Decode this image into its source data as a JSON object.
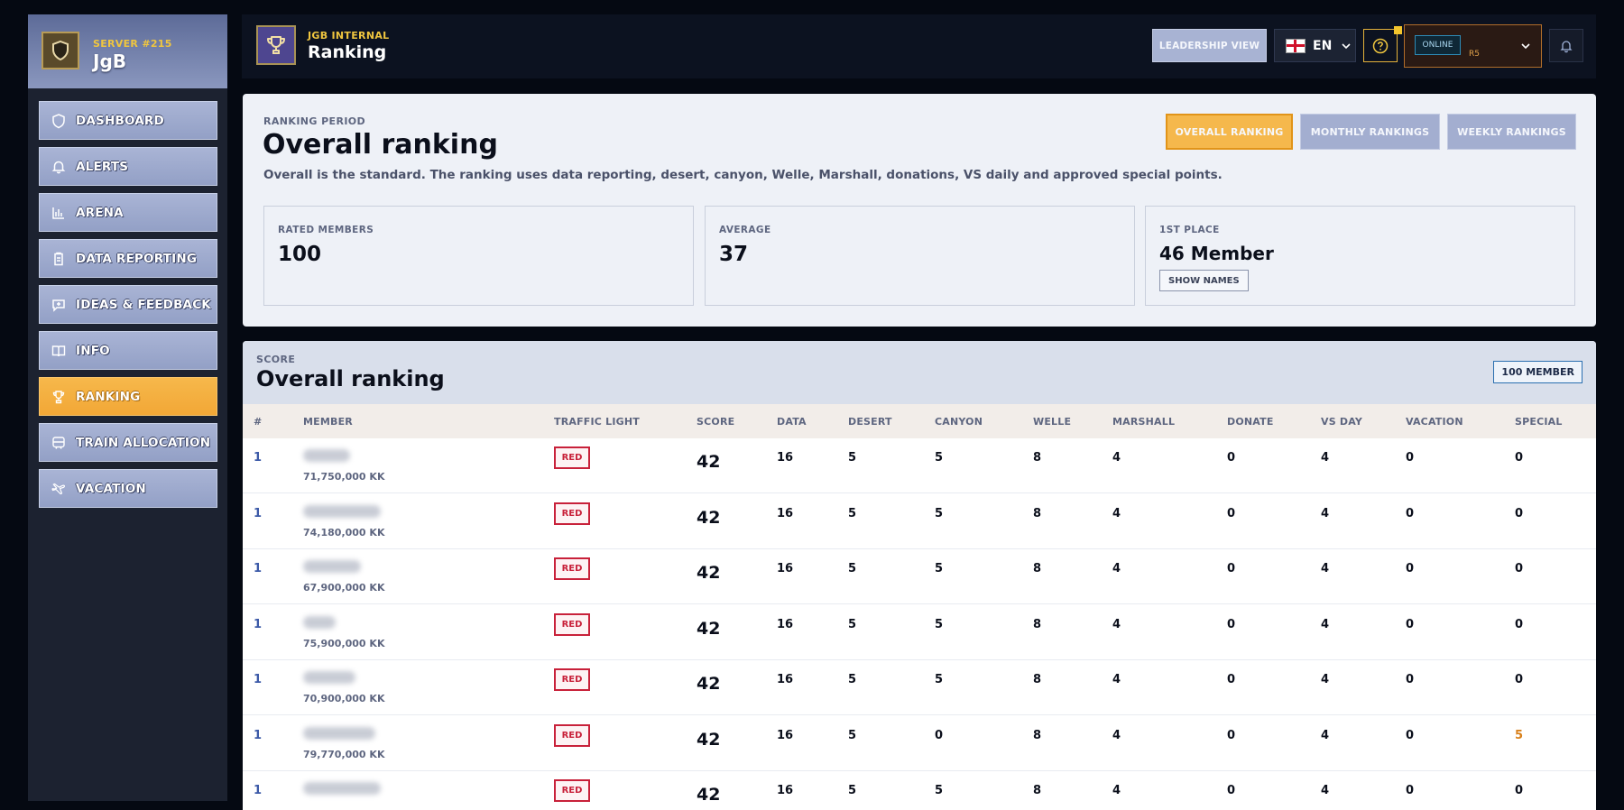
{
  "sidebar": {
    "server": "SERVER #215",
    "name": "JgB",
    "items": [
      {
        "label": "DASHBOARD",
        "icon": "shield-icon",
        "active": false
      },
      {
        "label": "ALERTS",
        "icon": "bell-icon",
        "active": false
      },
      {
        "label": "ARENA",
        "icon": "bar-chart-icon",
        "active": false
      },
      {
        "label": "DATA REPORTING",
        "icon": "clipboard-icon",
        "active": false
      },
      {
        "label": "IDEAS & FEEDBACK",
        "icon": "message-plus-icon",
        "active": false
      },
      {
        "label": "INFO",
        "icon": "book-icon",
        "active": false
      },
      {
        "label": "RANKING",
        "icon": "trophy-icon",
        "active": true
      },
      {
        "label": "TRAIN ALLOCATION",
        "icon": "train-icon",
        "active": false
      },
      {
        "label": "VACATION",
        "icon": "plane-icon",
        "active": false
      }
    ]
  },
  "topbar": {
    "section": "JGB INTERNAL",
    "title": "Ranking",
    "leadership": "LEADERSHIP VIEW",
    "lang": "EN",
    "status": "ONLINE",
    "rank": "R5"
  },
  "period": {
    "eyebrow": "RANKING PERIOD",
    "title": "Overall ranking",
    "description": "Overall is the standard. The ranking uses data reporting, desert, canyon, Welle, Marshall, donations, VS daily and approved special points.",
    "tabs": [
      "OVERALL RANKING",
      "MONTHLY RANKINGS",
      "WEEKLY RANKINGS"
    ],
    "active_tab": 0,
    "stats": [
      {
        "label": "RATED MEMBERS",
        "value": "100"
      },
      {
        "label": "AVERAGE",
        "value": "37"
      },
      {
        "label": "1ST PLACE",
        "value": "46 Member",
        "button": "SHOW NAMES"
      }
    ]
  },
  "score": {
    "eyebrow": "SCORE",
    "title": "Overall ranking",
    "member_count": "100 MEMBER",
    "columns": [
      "#",
      "MEMBER",
      "TRAFFIC LIGHT",
      "SCORE",
      "DATA",
      "DESERT",
      "CANYON",
      "WELLE",
      "MARSHALL",
      "DONATE",
      "VS DAY",
      "VACATION",
      "SPECIAL"
    ],
    "rows": [
      {
        "rank": "1",
        "member_value": "71,750,000 KK",
        "light": "RED",
        "score": "42",
        "data": "16",
        "desert": "5",
        "canyon": "5",
        "welle": "8",
        "marshall": "4",
        "donate": "0",
        "vs_day": "4",
        "vacation": "0",
        "special": "0"
      },
      {
        "rank": "1",
        "member_value": "74,180,000 KK",
        "light": "RED",
        "score": "42",
        "data": "16",
        "desert": "5",
        "canyon": "5",
        "welle": "8",
        "marshall": "4",
        "donate": "0",
        "vs_day": "4",
        "vacation": "0",
        "special": "0"
      },
      {
        "rank": "1",
        "member_value": "67,900,000 KK",
        "light": "RED",
        "score": "42",
        "data": "16",
        "desert": "5",
        "canyon": "5",
        "welle": "8",
        "marshall": "4",
        "donate": "0",
        "vs_day": "4",
        "vacation": "0",
        "special": "0"
      },
      {
        "rank": "1",
        "member_value": "75,900,000 KK",
        "light": "RED",
        "score": "42",
        "data": "16",
        "desert": "5",
        "canyon": "5",
        "welle": "8",
        "marshall": "4",
        "donate": "0",
        "vs_day": "4",
        "vacation": "0",
        "special": "0"
      },
      {
        "rank": "1",
        "member_value": "70,900,000 KK",
        "light": "RED",
        "score": "42",
        "data": "16",
        "desert": "5",
        "canyon": "5",
        "welle": "8",
        "marshall": "4",
        "donate": "0",
        "vs_day": "4",
        "vacation": "0",
        "special": "0"
      },
      {
        "rank": "1",
        "member_value": "79,770,000 KK",
        "light": "RED",
        "score": "42",
        "data": "16",
        "desert": "5",
        "canyon": "0",
        "welle": "8",
        "marshall": "4",
        "donate": "0",
        "vs_day": "4",
        "vacation": "0",
        "special": "5",
        "special_highlight": true
      },
      {
        "rank": "1",
        "member_value": "",
        "light": "RED",
        "score": "42",
        "data": "16",
        "desert": "5",
        "canyon": "5",
        "welle": "8",
        "marshall": "4",
        "donate": "0",
        "vs_day": "4",
        "vacation": "0",
        "special": "0"
      }
    ]
  },
  "colors": {
    "accent": "#f5b84c",
    "nav": "#a3aed0",
    "danger": "#c8213a",
    "highlight": "#d8801a"
  }
}
